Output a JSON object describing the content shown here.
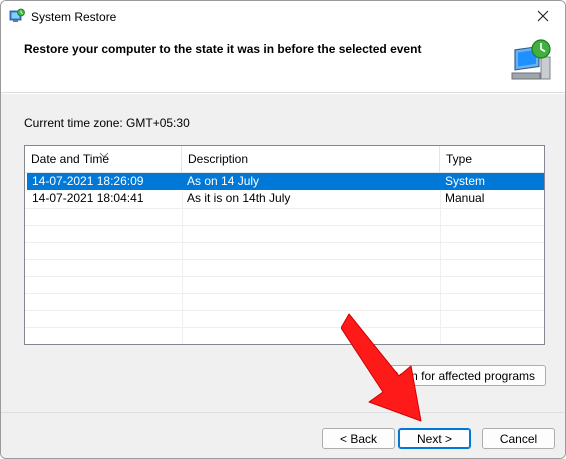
{
  "window": {
    "title": "System Restore",
    "heading": "Restore your computer to the state it was in before the selected event"
  },
  "timezone_label": "Current time zone: GMT+05:30",
  "table": {
    "columns": [
      "Date and Time",
      "Description",
      "Type"
    ],
    "rows": [
      {
        "date": "14-07-2021 18:26:09",
        "description": "As on 14 July",
        "type": "System",
        "selected": true
      },
      {
        "date": "14-07-2021 18:04:41",
        "description": "As it is on 14th July",
        "type": "Manual",
        "selected": false
      }
    ]
  },
  "buttons": {
    "scan": "Scan for affected programs",
    "back": "< Back",
    "next": "Next >",
    "cancel": "Cancel"
  },
  "icons": {
    "title": "system-restore-icon",
    "header": "computer-restore-icon",
    "close": "close-icon",
    "annotation": "red-arrow-icon"
  },
  "colors": {
    "selection": "#0078d7",
    "arrow": "#ff1a1a"
  }
}
